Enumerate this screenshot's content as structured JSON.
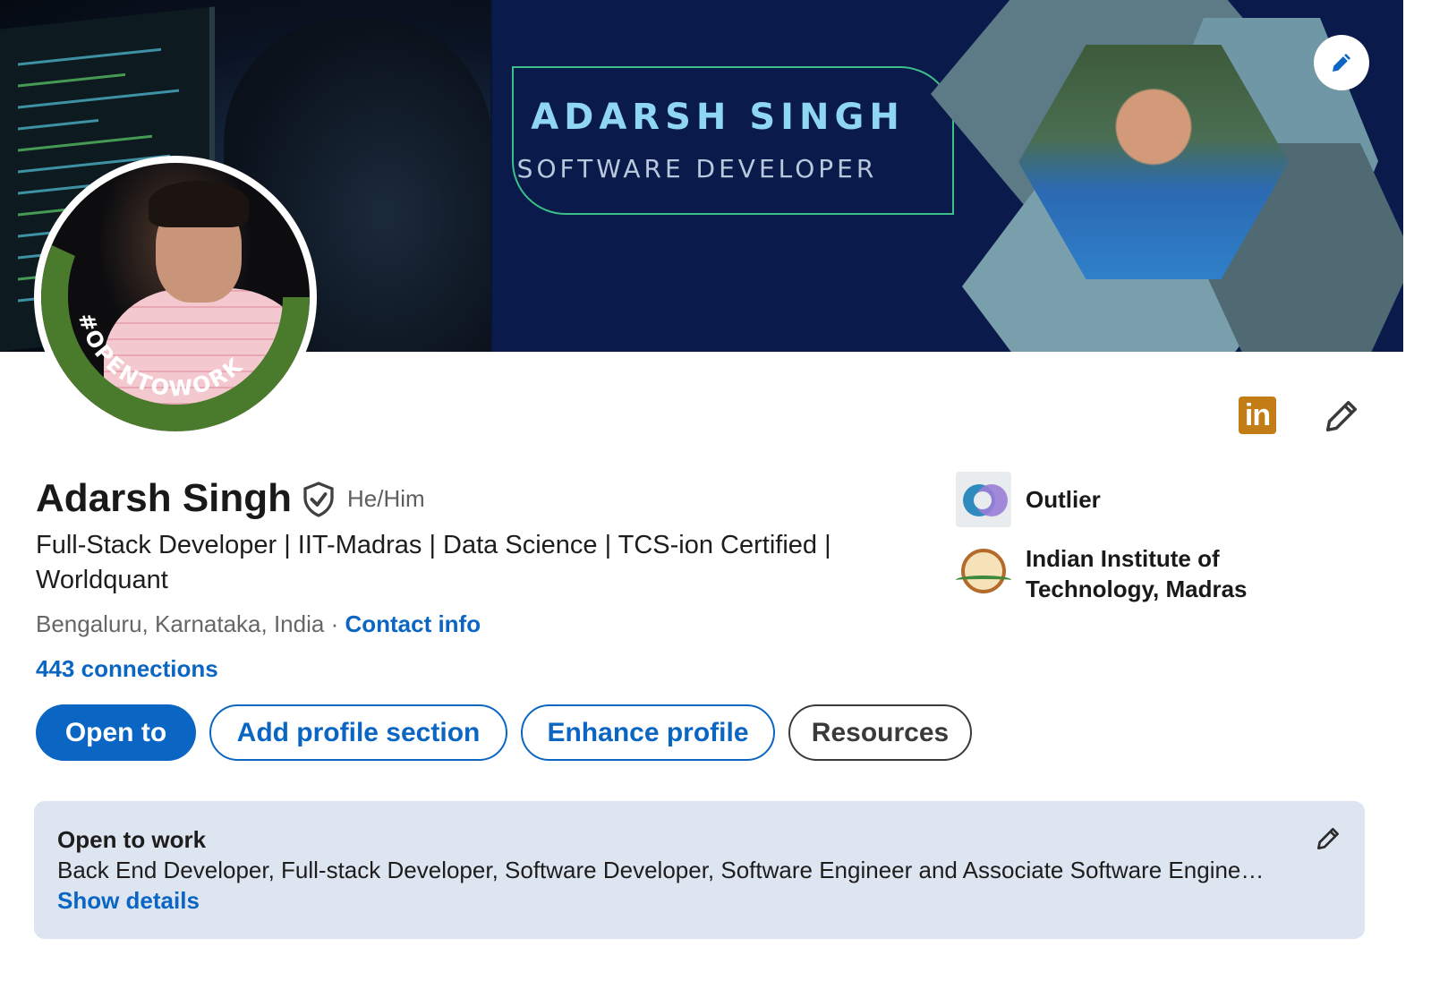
{
  "banner": {
    "name": "ADARSH SINGH",
    "role": "SOFTWARE DEVELOPER",
    "edit_icon": "pencil-icon"
  },
  "avatar": {
    "frame_text": "#OPENTOWORK",
    "frame_color": "#4a7a2c"
  },
  "profile": {
    "name": "Adarsh Singh",
    "pronouns": "He/Him",
    "headline": "Full-Stack Developer | IIT-Madras | Data Science | TCS-ion Certified | Worldquant",
    "location": "Bengaluru, Karnataka, India",
    "separator": " · ",
    "contact_label": "Contact info",
    "connections": "443 connections",
    "verified_icon": "shield-check-icon"
  },
  "top_icons": {
    "linkedin_badge": "in",
    "linkedin_color": "#c37d16",
    "edit_icon": "pencil-icon"
  },
  "organizations": [
    {
      "name": "Outlier",
      "logo": "outlier-logo"
    },
    {
      "name": "Indian Institute of Technology, Madras",
      "logo": "iit-madras-logo"
    }
  ],
  "actions": {
    "open_to": "Open to",
    "add_section": "Add profile section",
    "enhance": "Enhance profile",
    "resources": "Resources"
  },
  "open_to_work": {
    "title": "Open to work",
    "roles": "Back End Developer, Full-stack Developer, Software Developer, Software Engineer and Associate Software Engine…",
    "show_details": "Show details",
    "edit_icon": "pencil-icon"
  },
  "colors": {
    "primary": "#0a66c2",
    "banner_bg": "#0a1a4a",
    "card_bg": "#dde5f0"
  }
}
